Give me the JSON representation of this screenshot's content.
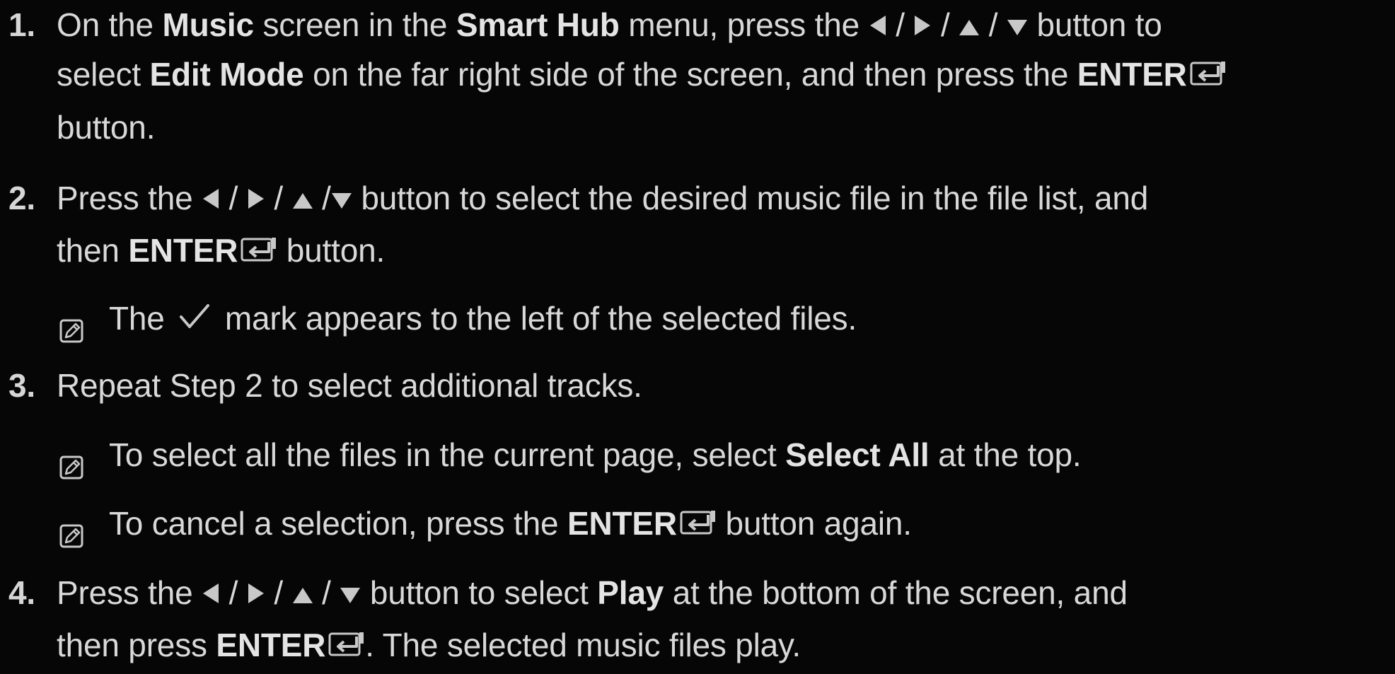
{
  "steps": [
    {
      "number": "1.",
      "segments": [
        {
          "t": "On the "
        },
        {
          "b": "Music"
        },
        {
          "t": " screen in the "
        },
        {
          "b": "Smart Hub"
        },
        {
          "t": " menu, press the "
        },
        {
          "icon": "left"
        },
        {
          "t": " / "
        },
        {
          "icon": "right"
        },
        {
          "t": " / "
        },
        {
          "icon": "up"
        },
        {
          "t": " / "
        },
        {
          "icon": "down"
        },
        {
          "t": " button to"
        }
      ]
    },
    {
      "segments": [
        {
          "t": "select "
        },
        {
          "b": "Edit Mode"
        },
        {
          "t": " on the far right side of the screen, and then press the "
        },
        {
          "b": "ENTER"
        },
        {
          "icon": "enter"
        }
      ]
    },
    {
      "segments": [
        {
          "t": "button."
        }
      ]
    },
    {
      "number": "2.",
      "segments": [
        {
          "t": "Press the "
        },
        {
          "icon": "left"
        },
        {
          "t": " / "
        },
        {
          "icon": "right"
        },
        {
          "t": " / "
        },
        {
          "icon": "up"
        },
        {
          "t": " /"
        },
        {
          "icon": "down"
        },
        {
          "t": " button to select the desired music file in the file list, and"
        }
      ]
    },
    {
      "segments": [
        {
          "t": "then "
        },
        {
          "b": "ENTER"
        },
        {
          "icon": "enter"
        },
        {
          "t": " button."
        }
      ]
    },
    {
      "note": true,
      "segments": [
        {
          "t": "The "
        },
        {
          "icon": "check"
        },
        {
          "t": " mark appears to the left of the selected files."
        }
      ]
    },
    {
      "number": "3.",
      "segments": [
        {
          "t": "Repeat Step 2 to select additional tracks."
        }
      ]
    },
    {
      "note": true,
      "segments": [
        {
          "t": "To select all the files in the current page, select "
        },
        {
          "b": "Select All"
        },
        {
          "t": " at the top."
        }
      ]
    },
    {
      "note": true,
      "segments": [
        {
          "t": "To cancel a selection, press the "
        },
        {
          "b": "ENTER"
        },
        {
          "icon": "enter"
        },
        {
          "t": " button again."
        }
      ]
    },
    {
      "number": "4.",
      "segments": [
        {
          "t": "Press the "
        },
        {
          "icon": "left"
        },
        {
          "t": " / "
        },
        {
          "icon": "right"
        },
        {
          "t": " / "
        },
        {
          "icon": "up"
        },
        {
          "t": " / "
        },
        {
          "icon": "down"
        },
        {
          "t": " button to select "
        },
        {
          "b": "Play"
        },
        {
          "t": " at the bottom of the screen, and"
        }
      ]
    },
    {
      "segments": [
        {
          "t": "then press "
        },
        {
          "b": "ENTER"
        },
        {
          "icon": "enter"
        },
        {
          "t": ". The selected music files play."
        }
      ]
    }
  ],
  "icons": {
    "left": "left-arrow-icon",
    "right": "right-arrow-icon",
    "up": "up-arrow-icon",
    "down": "down-arrow-icon",
    "enter": "enter-icon",
    "check": "checkmark-icon",
    "note": "note-icon"
  },
  "colors": {
    "background": "#060606",
    "text": "#d8d8d8",
    "bold": "#e4e4e4",
    "icon": "#c8c8c8"
  }
}
